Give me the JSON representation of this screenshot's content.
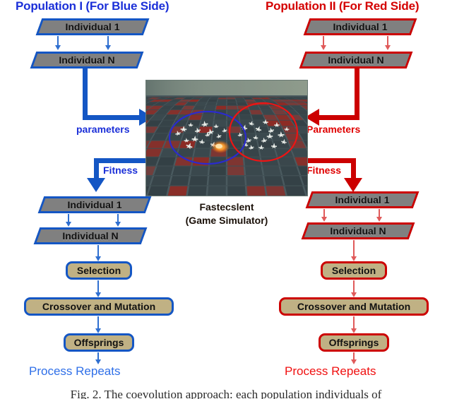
{
  "figure": {
    "caption": "Fig. 2.  The coevolution approach: each population individuals of"
  },
  "columns": [
    {
      "side": "blue",
      "title": "Population I (For Blue Side)",
      "accent": "#1456c4",
      "title_color": "#1b2fd8",
      "top_individuals": [
        "Individual 1",
        "Individual N"
      ],
      "bottom_individuals": [
        "Individual 1",
        "Individual N"
      ],
      "parameters_label": "parameters",
      "fitness_label": "Fitness",
      "process": [
        "Selection",
        "Crossover and Mutation",
        "Offsprings"
      ],
      "repeats": "Process Repeats"
    },
    {
      "side": "red",
      "title": "Population II (For Red Side)",
      "accent": "#cc0000",
      "title_color": "#d40000",
      "top_individuals": [
        "Individual 1",
        "Individual N"
      ],
      "bottom_individuals": [
        "Individual 1",
        "Individual N"
      ],
      "parameters_label": "Parameters",
      "fitness_label": "Fitness",
      "process": [
        "Selection",
        "Crossover and Mutation",
        "Offsprings"
      ],
      "repeats": "Process Repeats"
    }
  ],
  "simulator": {
    "name": "Fastecslent",
    "subtitle": "(Game Simulator)",
    "blue_group_marker": "blue-ellipse",
    "red_group_marker": "red-ellipse",
    "sky_color": "#6f7f74",
    "grid_color": "#3c4a50",
    "tile_red": "#8e2a24"
  },
  "palette": {
    "shape_fill": "#808080",
    "process_fill": "#c0b184",
    "blue": "#1456c4",
    "red": "#cc0000"
  }
}
